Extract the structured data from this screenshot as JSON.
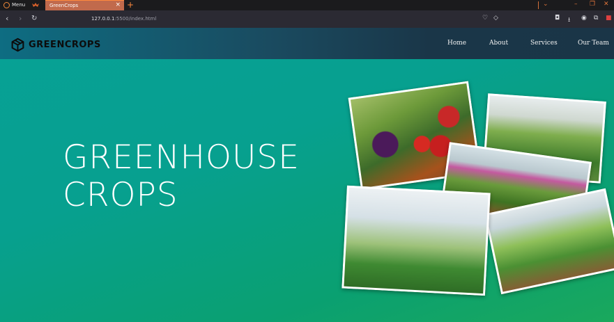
{
  "browser": {
    "menu_label": "Menu",
    "tab_title": "GreenCrops",
    "tab_close": "×",
    "new_tab": "+",
    "url_host": "127.0.0.1",
    "url_rest": ":5500/index.html",
    "accent_color": "#ff8a3d"
  },
  "site": {
    "brand": "GREENCROPS",
    "nav": [
      "Home",
      "About",
      "Services",
      "Our Team"
    ],
    "hero_line1": "GREENHOUSE",
    "hero_line2": "CROPS"
  }
}
